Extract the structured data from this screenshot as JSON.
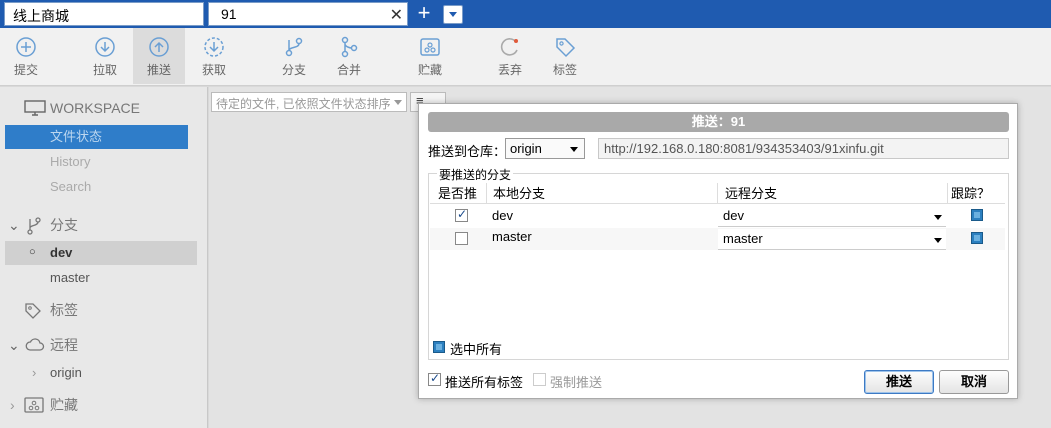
{
  "tabs": [
    {
      "label": "线上商城"
    },
    {
      "label": "91"
    }
  ],
  "toolbar": {
    "commit": "提交",
    "pull": "拉取",
    "push": "推送",
    "fetch": "获取",
    "branch": "分支",
    "merge": "合并",
    "stash": "贮藏",
    "discard": "丢弃",
    "tag": "标签"
  },
  "sidebar": {
    "workspace": "WORKSPACE",
    "file_status": "文件状态",
    "history": "History",
    "search": "Search",
    "branches": "分支",
    "branch_dev": "dev",
    "branch_master": "master",
    "tags": "标签",
    "remotes": "远程",
    "remote_origin": "origin",
    "stashes": "贮藏"
  },
  "main": {
    "filter": "待定的文件, 已依照文件状态排序"
  },
  "dialog": {
    "title": "推送：91",
    "repo_label": "推送到仓库：",
    "repo_value": "origin",
    "repo_url": "http://192.168.0.180:8081/934353403/91xinfu.git",
    "group_label": "要推送的分支",
    "columns": {
      "push": "是否推",
      "local": "本地分支",
      "remote": "远程分支",
      "track": "跟踪？"
    },
    "rows": [
      {
        "local": "dev",
        "remote": "dev",
        "checked": true
      },
      {
        "local": "master",
        "remote": "master",
        "checked": false
      }
    ],
    "select_all": "选中所有",
    "push_all_tags": "推送所有标签",
    "force_push": "强制推送",
    "ok": "推送",
    "cancel": "取消"
  }
}
